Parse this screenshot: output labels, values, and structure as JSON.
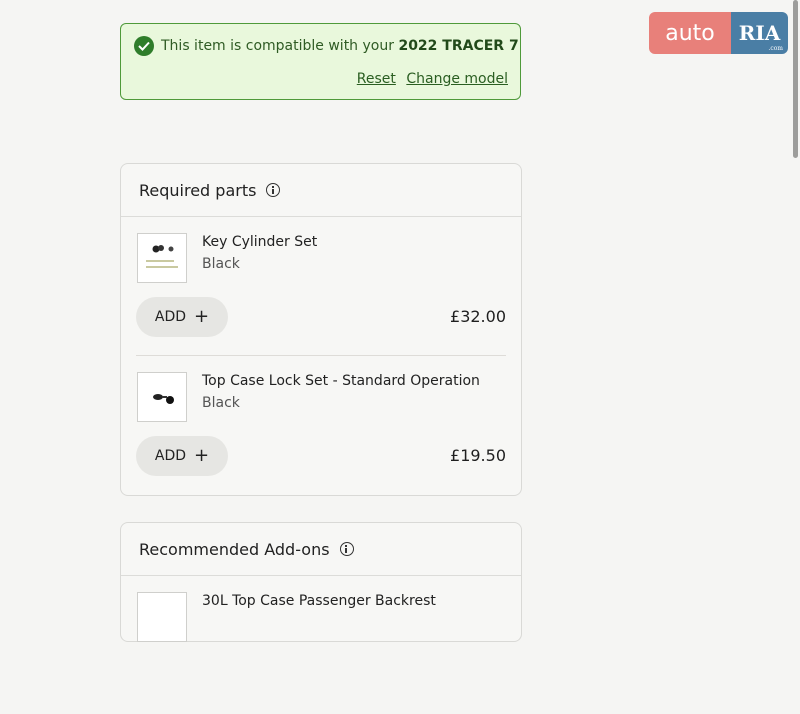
{
  "compat": {
    "message_prefix": "This item is compatible with your ",
    "model": "2022 TRACER 7",
    "reset": "Reset",
    "change_model": "Change model"
  },
  "required": {
    "title": "Required parts",
    "items": [
      {
        "name": "Key Cylinder Set",
        "color": "Black",
        "add": "ADD",
        "price": "£32.00"
      },
      {
        "name": "Top Case Lock Set - Standard Operation",
        "color": "Black",
        "add": "ADD",
        "price": "£19.50"
      }
    ]
  },
  "recommended": {
    "title": "Recommended Add-ons",
    "items": [
      {
        "name": "30L Top Case Passenger Backrest"
      }
    ]
  },
  "watermark": {
    "left": "auto",
    "right": "RIA",
    "sub": ".com"
  },
  "colors": {
    "success": "#2f7d2b",
    "success_bg": "#e9f8dc",
    "card_border": "#d9d9d6"
  }
}
